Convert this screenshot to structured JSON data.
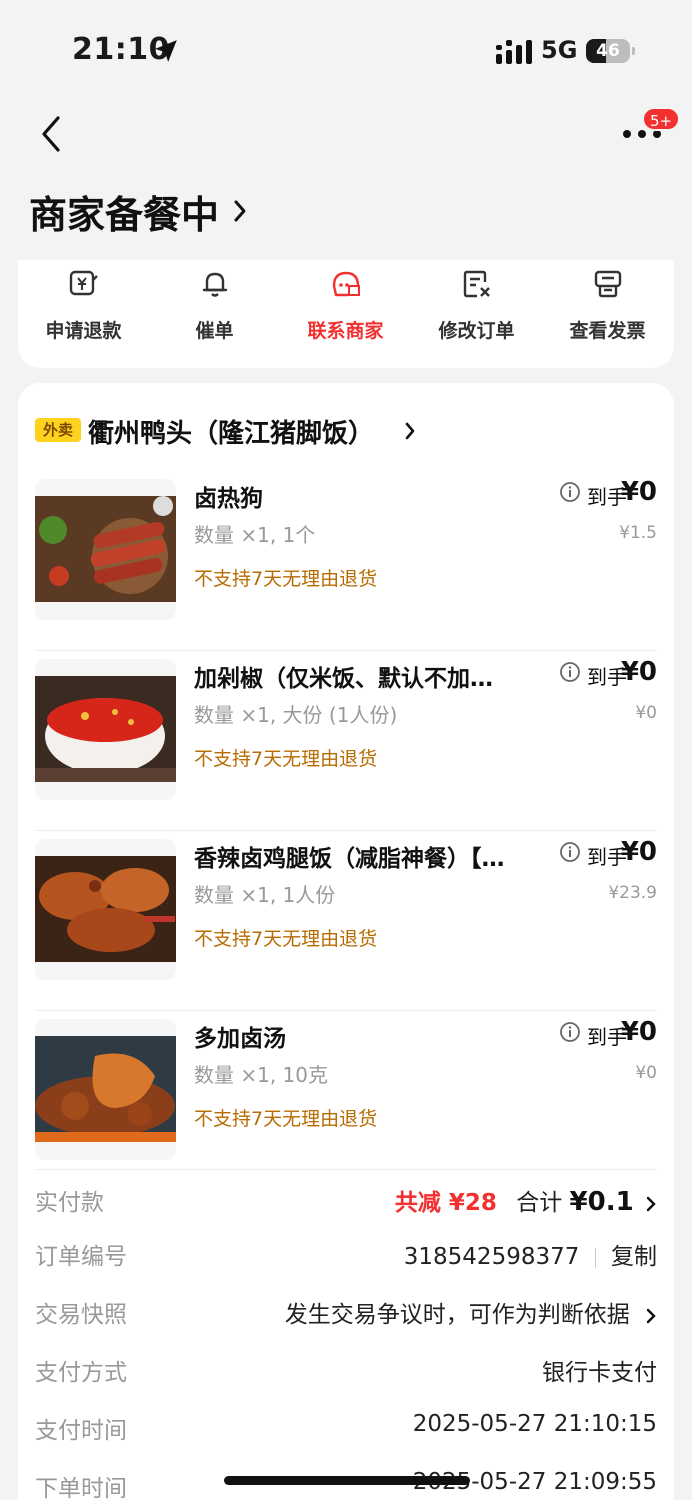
{
  "status": {
    "time": "21:10",
    "network": "5G",
    "battery": "46",
    "battery_level": 0.46
  },
  "nav": {
    "badge": "5+"
  },
  "header": {
    "title": "商家备餐中"
  },
  "actions": [
    {
      "label": "申请退款",
      "icon": "refund-icon"
    },
    {
      "label": "催单",
      "icon": "bell-icon"
    },
    {
      "label": "联系商家",
      "icon": "chat-store-icon",
      "active": true
    },
    {
      "label": "修改订单",
      "icon": "edit-order-icon"
    },
    {
      "label": "查看发票",
      "icon": "invoice-icon"
    }
  ],
  "shop": {
    "tag": "外卖",
    "name": "衢州鸭头（隆江猪脚饭）"
  },
  "items": [
    {
      "name": "卤热狗",
      "spec": "数量 ×1, 1个",
      "policy": "不支持7天无理由退货",
      "price_label": "到手",
      "price": "¥0",
      "original": "¥1.5",
      "image": "hotdog-photo"
    },
    {
      "name": "加剁椒（仅米饭、默认不加…",
      "spec": "数量 ×1, 大份 (1人份)",
      "policy": "不支持7天无理由退货",
      "price_label": "到手",
      "price": "¥0",
      "original": "¥0",
      "image": "chili-photo"
    },
    {
      "name": "香辣卤鸡腿饭（减脂神餐）【…",
      "spec": "数量 ×1, 1人份",
      "policy": "不支持7天无理由退货",
      "price_label": "到手",
      "price": "¥0",
      "original": "¥23.9",
      "image": "chicken-leg-photo"
    },
    {
      "name": "多加卤汤",
      "spec": "数量 ×1, 10克",
      "policy": "不支持7天无理由退货",
      "price_label": "到手",
      "price": "¥0",
      "original": "¥0",
      "image": "braised-photo"
    }
  ],
  "summary": {
    "paid_label": "实付款",
    "discount": "共减 ¥28",
    "total_label": "合计",
    "total": "¥0.1",
    "order_no_label": "订单编号",
    "order_no": "318542598377",
    "copy_label": "复制",
    "snapshot_label": "交易快照",
    "snapshot_value": "发生交易争议时，可作为判断依据",
    "payment_label": "支付方式",
    "payment_value": "银行卡支付",
    "pay_time_label": "支付时间",
    "pay_time": "2025-05-27 21:10:15",
    "order_time_label": "下单时间",
    "order_time": "2025-05-27 21:09:55"
  },
  "colors": {
    "accent": "#f23030",
    "policy": "#b86b00",
    "tag_bg": "#ffd21e"
  }
}
